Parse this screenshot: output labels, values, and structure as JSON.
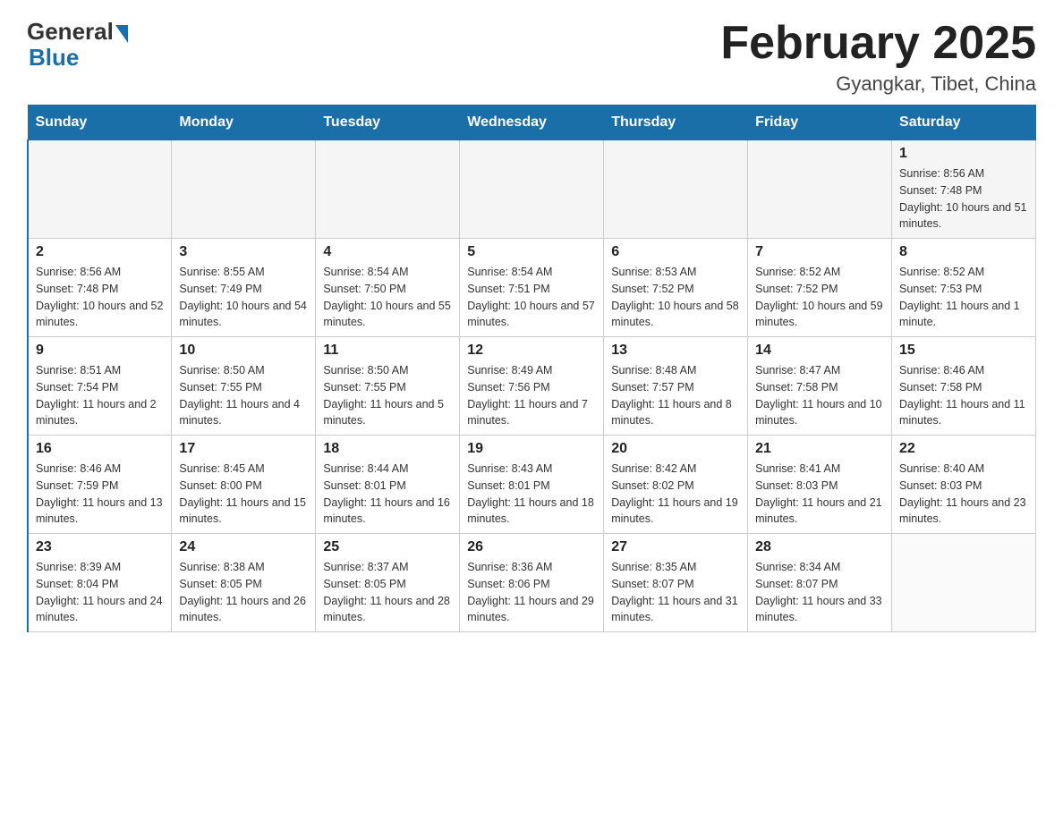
{
  "logo": {
    "general": "General",
    "blue": "Blue"
  },
  "title": "February 2025",
  "subtitle": "Gyangkar, Tibet, China",
  "days_of_week": [
    "Sunday",
    "Monday",
    "Tuesday",
    "Wednesday",
    "Thursday",
    "Friday",
    "Saturday"
  ],
  "weeks": [
    [
      {
        "day": "",
        "info": ""
      },
      {
        "day": "",
        "info": ""
      },
      {
        "day": "",
        "info": ""
      },
      {
        "day": "",
        "info": ""
      },
      {
        "day": "",
        "info": ""
      },
      {
        "day": "",
        "info": ""
      },
      {
        "day": "1",
        "info": "Sunrise: 8:56 AM\nSunset: 7:48 PM\nDaylight: 10 hours and 51 minutes."
      }
    ],
    [
      {
        "day": "2",
        "info": "Sunrise: 8:56 AM\nSunset: 7:48 PM\nDaylight: 10 hours and 52 minutes."
      },
      {
        "day": "3",
        "info": "Sunrise: 8:55 AM\nSunset: 7:49 PM\nDaylight: 10 hours and 54 minutes."
      },
      {
        "day": "4",
        "info": "Sunrise: 8:54 AM\nSunset: 7:50 PM\nDaylight: 10 hours and 55 minutes."
      },
      {
        "day": "5",
        "info": "Sunrise: 8:54 AM\nSunset: 7:51 PM\nDaylight: 10 hours and 57 minutes."
      },
      {
        "day": "6",
        "info": "Sunrise: 8:53 AM\nSunset: 7:52 PM\nDaylight: 10 hours and 58 minutes."
      },
      {
        "day": "7",
        "info": "Sunrise: 8:52 AM\nSunset: 7:52 PM\nDaylight: 10 hours and 59 minutes."
      },
      {
        "day": "8",
        "info": "Sunrise: 8:52 AM\nSunset: 7:53 PM\nDaylight: 11 hours and 1 minute."
      }
    ],
    [
      {
        "day": "9",
        "info": "Sunrise: 8:51 AM\nSunset: 7:54 PM\nDaylight: 11 hours and 2 minutes."
      },
      {
        "day": "10",
        "info": "Sunrise: 8:50 AM\nSunset: 7:55 PM\nDaylight: 11 hours and 4 minutes."
      },
      {
        "day": "11",
        "info": "Sunrise: 8:50 AM\nSunset: 7:55 PM\nDaylight: 11 hours and 5 minutes."
      },
      {
        "day": "12",
        "info": "Sunrise: 8:49 AM\nSunset: 7:56 PM\nDaylight: 11 hours and 7 minutes."
      },
      {
        "day": "13",
        "info": "Sunrise: 8:48 AM\nSunset: 7:57 PM\nDaylight: 11 hours and 8 minutes."
      },
      {
        "day": "14",
        "info": "Sunrise: 8:47 AM\nSunset: 7:58 PM\nDaylight: 11 hours and 10 minutes."
      },
      {
        "day": "15",
        "info": "Sunrise: 8:46 AM\nSunset: 7:58 PM\nDaylight: 11 hours and 11 minutes."
      }
    ],
    [
      {
        "day": "16",
        "info": "Sunrise: 8:46 AM\nSunset: 7:59 PM\nDaylight: 11 hours and 13 minutes."
      },
      {
        "day": "17",
        "info": "Sunrise: 8:45 AM\nSunset: 8:00 PM\nDaylight: 11 hours and 15 minutes."
      },
      {
        "day": "18",
        "info": "Sunrise: 8:44 AM\nSunset: 8:01 PM\nDaylight: 11 hours and 16 minutes."
      },
      {
        "day": "19",
        "info": "Sunrise: 8:43 AM\nSunset: 8:01 PM\nDaylight: 11 hours and 18 minutes."
      },
      {
        "day": "20",
        "info": "Sunrise: 8:42 AM\nSunset: 8:02 PM\nDaylight: 11 hours and 19 minutes."
      },
      {
        "day": "21",
        "info": "Sunrise: 8:41 AM\nSunset: 8:03 PM\nDaylight: 11 hours and 21 minutes."
      },
      {
        "day": "22",
        "info": "Sunrise: 8:40 AM\nSunset: 8:03 PM\nDaylight: 11 hours and 23 minutes."
      }
    ],
    [
      {
        "day": "23",
        "info": "Sunrise: 8:39 AM\nSunset: 8:04 PM\nDaylight: 11 hours and 24 minutes."
      },
      {
        "day": "24",
        "info": "Sunrise: 8:38 AM\nSunset: 8:05 PM\nDaylight: 11 hours and 26 minutes."
      },
      {
        "day": "25",
        "info": "Sunrise: 8:37 AM\nSunset: 8:05 PM\nDaylight: 11 hours and 28 minutes."
      },
      {
        "day": "26",
        "info": "Sunrise: 8:36 AM\nSunset: 8:06 PM\nDaylight: 11 hours and 29 minutes."
      },
      {
        "day": "27",
        "info": "Sunrise: 8:35 AM\nSunset: 8:07 PM\nDaylight: 11 hours and 31 minutes."
      },
      {
        "day": "28",
        "info": "Sunrise: 8:34 AM\nSunset: 8:07 PM\nDaylight: 11 hours and 33 minutes."
      },
      {
        "day": "",
        "info": ""
      }
    ]
  ]
}
